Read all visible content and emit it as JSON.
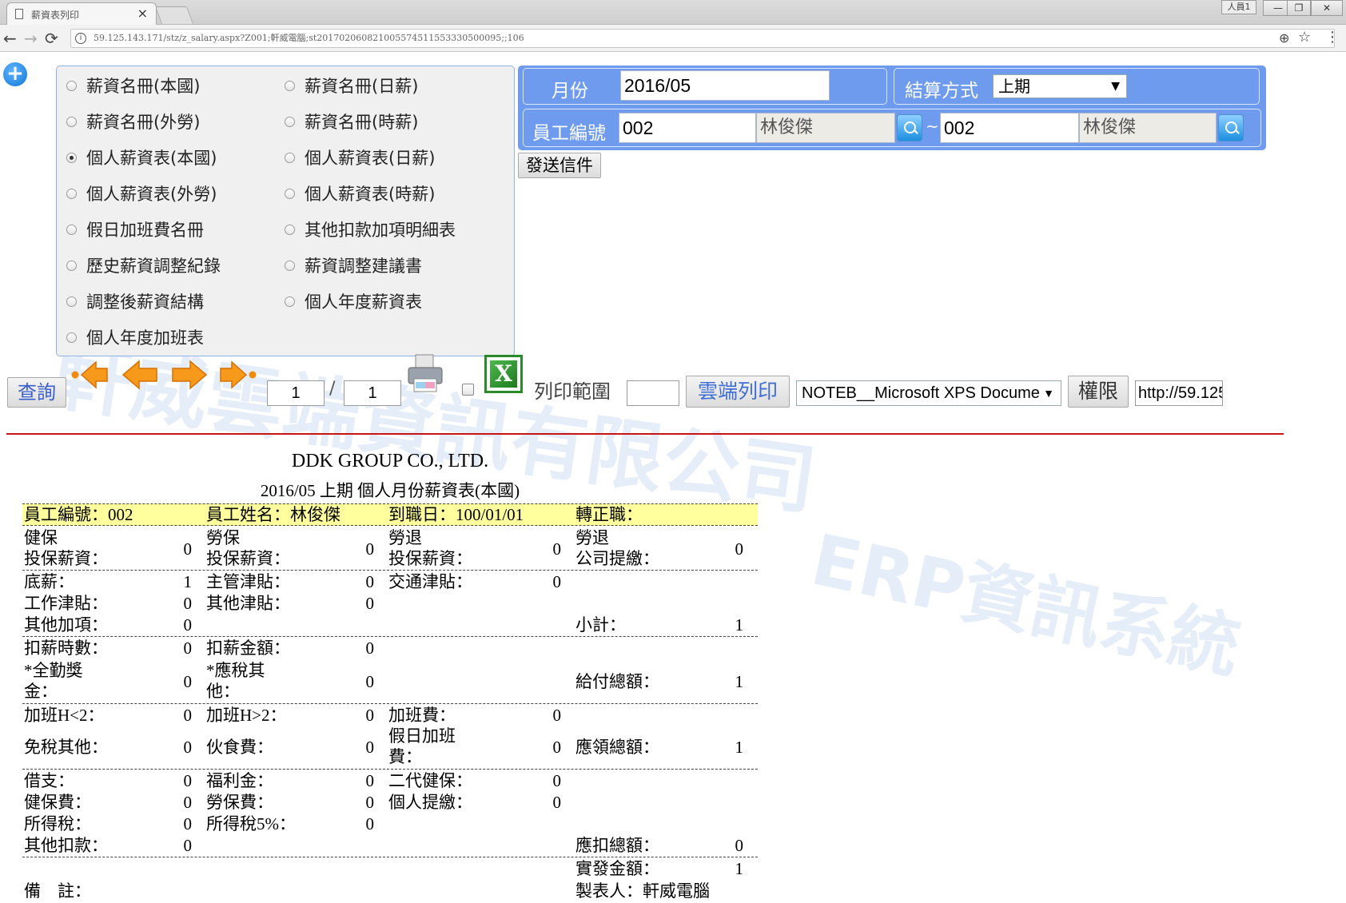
{
  "browser": {
    "tab_title": "薪資表列印",
    "tab_close": "×",
    "url": "59.125.143.171/stz/z_salary.aspx?Z001;軒威電腦;st201702060821005574511553330500095;;106",
    "window_buttons": [
      "—",
      "❐",
      "✕"
    ],
    "user_badge": "人員1"
  },
  "report_options": [
    {
      "label": "薪資名冊(本國)",
      "selected": false
    },
    {
      "label": "薪資名冊(日薪)",
      "selected": false
    },
    {
      "label": "薪資名冊(外勞)",
      "selected": false
    },
    {
      "label": "薪資名冊(時薪)",
      "selected": false
    },
    {
      "label": "個人薪資表(本國)",
      "selected": true
    },
    {
      "label": "個人薪資表(日薪)",
      "selected": false
    },
    {
      "label": "個人薪資表(外勞)",
      "selected": false
    },
    {
      "label": "個人薪資表(時薪)",
      "selected": false
    },
    {
      "label": "假日加班費名冊",
      "selected": false
    },
    {
      "label": "其他扣款加項明細表",
      "selected": false
    },
    {
      "label": "歷史薪資調整紀錄",
      "selected": false
    },
    {
      "label": "薪資調整建議書",
      "selected": false
    },
    {
      "label": "調整後薪資結構",
      "selected": false
    },
    {
      "label": "個人年度薪資表",
      "selected": false
    },
    {
      "label": "個人年度加班表",
      "selected": false
    }
  ],
  "params": {
    "month_label": "月份",
    "month_value": "2016/05",
    "settle_label": "結算方式",
    "settle_value": "上期",
    "emp_label": "員工編號",
    "emp_from_id": "002",
    "emp_from_name": "林俊傑",
    "tilde": "~",
    "emp_to_id": "002",
    "emp_to_name": "林俊傑"
  },
  "toolbar": {
    "send_mail": "發送信件",
    "query": "查詢",
    "page_current": "1",
    "page_sep": "/",
    "page_total": "1",
    "print_range_label": "列印範圍",
    "cloud_print": "雲端列印",
    "printer_value": "NOTEB__Microsoft XPS Docume",
    "permission": "權限",
    "url_field": "http://59.125"
  },
  "watermark": {
    "company": "軒威雲端資訊有限公司",
    "system": "ERP資訊系統"
  },
  "report": {
    "company": "DDK GROUP CO., LTD.",
    "subtitle": "2016/05 上期 個人月份薪資表(本國)",
    "emp_no": "員工編號：002",
    "emp_name": "員工姓名：林俊傑",
    "join_date": "到職日：100/01/01",
    "regular": "轉正職：",
    "health_ins_l1": "健保",
    "health_ins_l2": "投保薪資：",
    "health_ins_v": "0",
    "labor_ins_l1": "勞保",
    "labor_ins_l2": "投保薪資：",
    "labor_ins_v": "0",
    "pension_l1": "勞退",
    "pension_l2": "投保薪資：",
    "pension_v": "0",
    "pension_co_l1": "勞退",
    "pension_co_l2": "公司提繳：",
    "pension_co_v": "0",
    "base": "底薪：",
    "base_v": "1",
    "mgr": "主管津貼：",
    "mgr_v": "0",
    "traffic": "交通津貼：",
    "traffic_v": "0",
    "work": "工作津貼：",
    "work_v": "0",
    "other_allow": "其他津貼：",
    "other_allow_v": "0",
    "other_add": "其他加項：",
    "other_add_v": "0",
    "subtotal": "小計：",
    "subtotal_v": "1",
    "deduct_hours": "扣薪時數：",
    "deduct_hours_v": "0",
    "deduct_amt": "扣薪金額：",
    "deduct_amt_v": "0",
    "attend_l1": "*全勤獎",
    "attend_l2": "金：",
    "attend_v": "0",
    "tax_other_l1": "*應稅其",
    "tax_other_l2": "他：",
    "tax_other_v": "0",
    "pay_total": "給付總額：",
    "pay_total_v": "1",
    "ot1": "加班H<2：",
    "ot1_v": "0",
    "ot2": "加班H>2：",
    "ot2_v": "0",
    "ot_fee": "加班費：",
    "ot_fee_v": "0",
    "taxfree": "免稅其他：",
    "taxfree_v": "0",
    "meal": "伙食費：",
    "meal_v": "0",
    "holiday_l1": "假日加班",
    "holiday_l2": "費：",
    "holiday_v": "0",
    "receivable": "應領總額：",
    "receivable_v": "1",
    "loan": "借支：",
    "loan_v": "0",
    "welfare": "福利金：",
    "welfare_v": "0",
    "nhi2": "二代健保：",
    "nhi2_v": "0",
    "health_fee": "健保費：",
    "health_fee_v": "0",
    "labor_fee": "勞保費：",
    "labor_fee_v": "0",
    "self_pension": "個人提繳：",
    "self_pension_v": "0",
    "income_tax": "所得稅：",
    "income_tax_v": "0",
    "income_tax5": "所得稅5%：",
    "income_tax5_v": "0",
    "other_deduct": "其他扣款：",
    "other_deduct_v": "0",
    "deduct_total": "應扣總額：",
    "deduct_total_v": "0",
    "net_pay": "實發金額：",
    "net_pay_v": "1",
    "remark": "備　註：",
    "maker": "製表人：軒威電腦"
  }
}
